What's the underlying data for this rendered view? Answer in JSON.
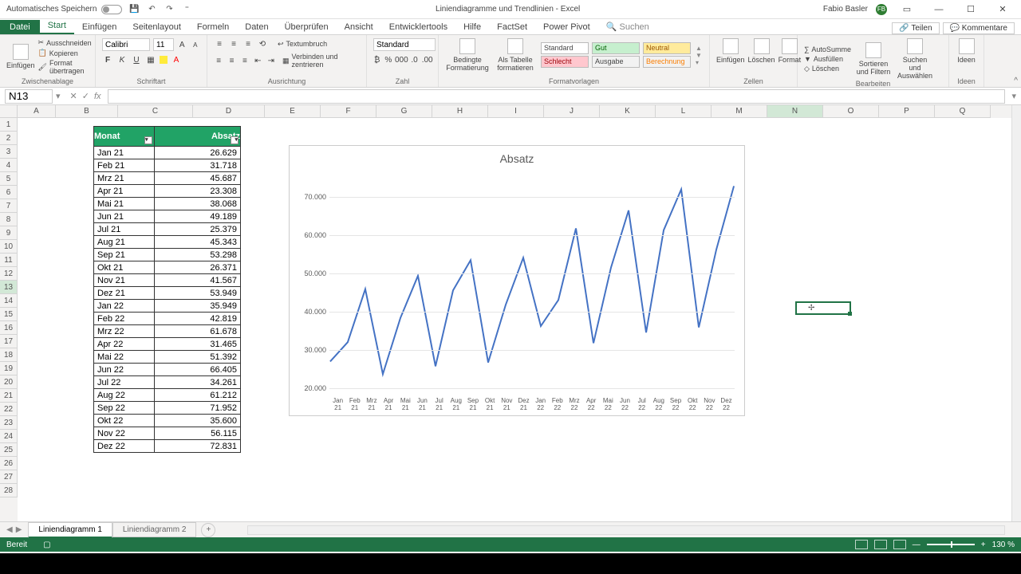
{
  "title": {
    "autosave": "Automatisches Speichern",
    "doc": "Liniendiagramme und Trendlinien",
    "app": "Excel",
    "user": "Fabio Basler"
  },
  "tabs": {
    "file": "Datei",
    "items": [
      "Start",
      "Einfügen",
      "Seitenlayout",
      "Formeln",
      "Daten",
      "Überprüfen",
      "Ansicht",
      "Entwicklertools",
      "Hilfe",
      "FactSet",
      "Power Pivot"
    ],
    "search": "Suchen",
    "share": "Teilen",
    "comments": "Kommentare"
  },
  "ribbon": {
    "clipboard": {
      "paste": "Einfügen",
      "cut": "Ausschneiden",
      "copy": "Kopieren",
      "format_painter": "Format übertragen",
      "label": "Zwischenablage"
    },
    "font": {
      "name": "Calibri",
      "size": "11",
      "label": "Schriftart"
    },
    "align": {
      "wrap": "Textumbruch",
      "merge": "Verbinden und zentrieren",
      "label": "Ausrichtung"
    },
    "number": {
      "format": "Standard",
      "label": "Zahl"
    },
    "styles": {
      "cond": "Bedingte Formatierung",
      "table": "Als Tabelle formatieren",
      "s1": "Standard",
      "s2": "Gut",
      "s3": "Neutral",
      "s4": "Schlecht",
      "s5": "Ausgabe",
      "s6": "Berechnung",
      "label": "Formatvorlagen"
    },
    "cells": {
      "insert": "Einfügen",
      "delete": "Löschen",
      "format": "Format",
      "label": "Zellen"
    },
    "editing": {
      "sum": "AutoSumme",
      "fill": "Ausfüllen",
      "clear": "Löschen",
      "sort": "Sortieren und Filtern",
      "find": "Suchen und Auswählen",
      "label": "Bearbeiten"
    },
    "ideas": {
      "btn": "Ideen",
      "label": "Ideen"
    }
  },
  "namebox": "N13",
  "columns": [
    "A",
    "B",
    "C",
    "D",
    "E",
    "F",
    "G",
    "H",
    "I",
    "J",
    "K",
    "L",
    "M",
    "N",
    "O",
    "P",
    "Q"
  ],
  "table": {
    "h1": "Monat",
    "h2": "Absatz",
    "rows": [
      {
        "m": "Jan 21",
        "v": "26.629"
      },
      {
        "m": "Feb 21",
        "v": "31.718"
      },
      {
        "m": "Mrz 21",
        "v": "45.687"
      },
      {
        "m": "Apr 21",
        "v": "23.308"
      },
      {
        "m": "Mai 21",
        "v": "38.068"
      },
      {
        "m": "Jun 21",
        "v": "49.189"
      },
      {
        "m": "Jul 21",
        "v": "25.379"
      },
      {
        "m": "Aug 21",
        "v": "45.343"
      },
      {
        "m": "Sep 21",
        "v": "53.298"
      },
      {
        "m": "Okt 21",
        "v": "26.371"
      },
      {
        "m": "Nov 21",
        "v": "41.567"
      },
      {
        "m": "Dez 21",
        "v": "53.949"
      },
      {
        "m": "Jan 22",
        "v": "35.949"
      },
      {
        "m": "Feb 22",
        "v": "42.819"
      },
      {
        "m": "Mrz 22",
        "v": "61.678"
      },
      {
        "m": "Apr 22",
        "v": "31.465"
      },
      {
        "m": "Mai 22",
        "v": "51.392"
      },
      {
        "m": "Jun 22",
        "v": "66.405"
      },
      {
        "m": "Jul 22",
        "v": "34.261"
      },
      {
        "m": "Aug 22",
        "v": "61.212"
      },
      {
        "m": "Sep 22",
        "v": "71.952"
      },
      {
        "m": "Okt 22",
        "v": "35.600"
      },
      {
        "m": "Nov 22",
        "v": "56.115"
      },
      {
        "m": "Dez 22",
        "v": "72.831"
      }
    ]
  },
  "chart_data": {
    "type": "line",
    "title": "Absatz",
    "xlabel": "",
    "ylabel": "",
    "ylim": [
      20000,
      75000
    ],
    "yticks": [
      20000,
      30000,
      40000,
      50000,
      60000,
      70000
    ],
    "yticklabels": [
      "20.000",
      "30.000",
      "40.000",
      "50.000",
      "60.000",
      "70.000"
    ],
    "categories": [
      "Jan 21",
      "Feb 21",
      "Mrz 21",
      "Apr 21",
      "Mai 21",
      "Jun 21",
      "Jul 21",
      "Aug 21",
      "Sep 21",
      "Okt 21",
      "Nov 21",
      "Dez 21",
      "Jan 22",
      "Feb 22",
      "Mrz 22",
      "Apr 22",
      "Mai 22",
      "Jun 22",
      "Jul 22",
      "Aug 22",
      "Sep 22",
      "Okt 22",
      "Nov 22",
      "Dez 22"
    ],
    "xticklabels": [
      "Jan\n21",
      "Feb\n21",
      "Mrz\n21",
      "Apr\n21",
      "Mai\n21",
      "Jun\n21",
      "Jul\n21",
      "Aug\n21",
      "Sep\n21",
      "Okt\n21",
      "Nov\n21",
      "Dez\n21",
      "Jan\n22",
      "Feb\n22",
      "Mrz\n22",
      "Apr\n22",
      "Mai\n22",
      "Jun\n22",
      "Jul\n22",
      "Aug\n22",
      "Sep\n22",
      "Okt\n22",
      "Nov\n22",
      "Dez\n22"
    ],
    "values": [
      26629,
      31718,
      45687,
      23308,
      38068,
      49189,
      25379,
      45343,
      53298,
      26371,
      41567,
      53949,
      35949,
      42819,
      61678,
      31465,
      51392,
      66405,
      34261,
      61212,
      71952,
      35600,
      56115,
      72831
    ]
  },
  "sheets": {
    "s1": "Liniendiagramm 1",
    "s2": "Liniendiagramm 2"
  },
  "status": {
    "ready": "Bereit",
    "zoom": "130 %"
  }
}
